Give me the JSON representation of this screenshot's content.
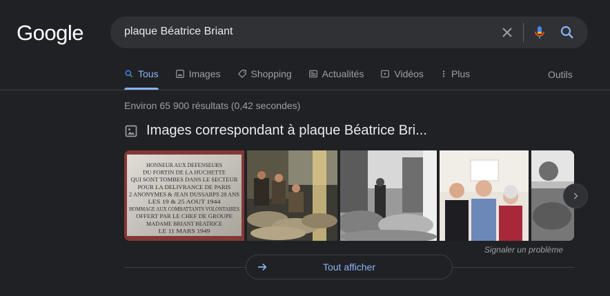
{
  "logo": "Google",
  "search": {
    "query": "plaque Béatrice Briant"
  },
  "tabs": [
    {
      "label": "Tous",
      "icon": "search-icon",
      "active": true
    },
    {
      "label": "Images",
      "icon": "image-icon"
    },
    {
      "label": "Shopping",
      "icon": "tag-icon"
    },
    {
      "label": "Actualités",
      "icon": "news-icon"
    },
    {
      "label": "Vidéos",
      "icon": "video-icon"
    },
    {
      "label": "Plus",
      "icon": "more-vert-icon"
    }
  ],
  "tools_label": "Outils",
  "result_stats": "Environ 65 900 résultats (0,42 secondes)",
  "images_section": {
    "title": "Images correspondant à plaque Béatrice Bri...",
    "plaque_lines": [
      "HONNEUR AUX DEFENSEURS",
      "DU FORTIN DE LA HUCHETTE",
      "QUI SONT TOMBES DANS LE SECTEUR",
      "POUR LA DELIVRANCE DE PARIS",
      "2 ANONYMES & JEAN DUSSARPS 28 ANS",
      "LES 19 & 25 AOUT 1944",
      "HOMMAGE AUX COMBATTANTS VOLONTAIRES",
      "OFFERT PAR LE CHEF DE GROUPE",
      "MADAME BRIANT BEATRICE",
      "LE 11 MARS 1949"
    ],
    "report_label": "Signaler un problème",
    "show_all_label": "Tout afficher"
  },
  "colors": {
    "accent": "#8ab4f8",
    "background": "#202124",
    "surface": "#303134"
  }
}
